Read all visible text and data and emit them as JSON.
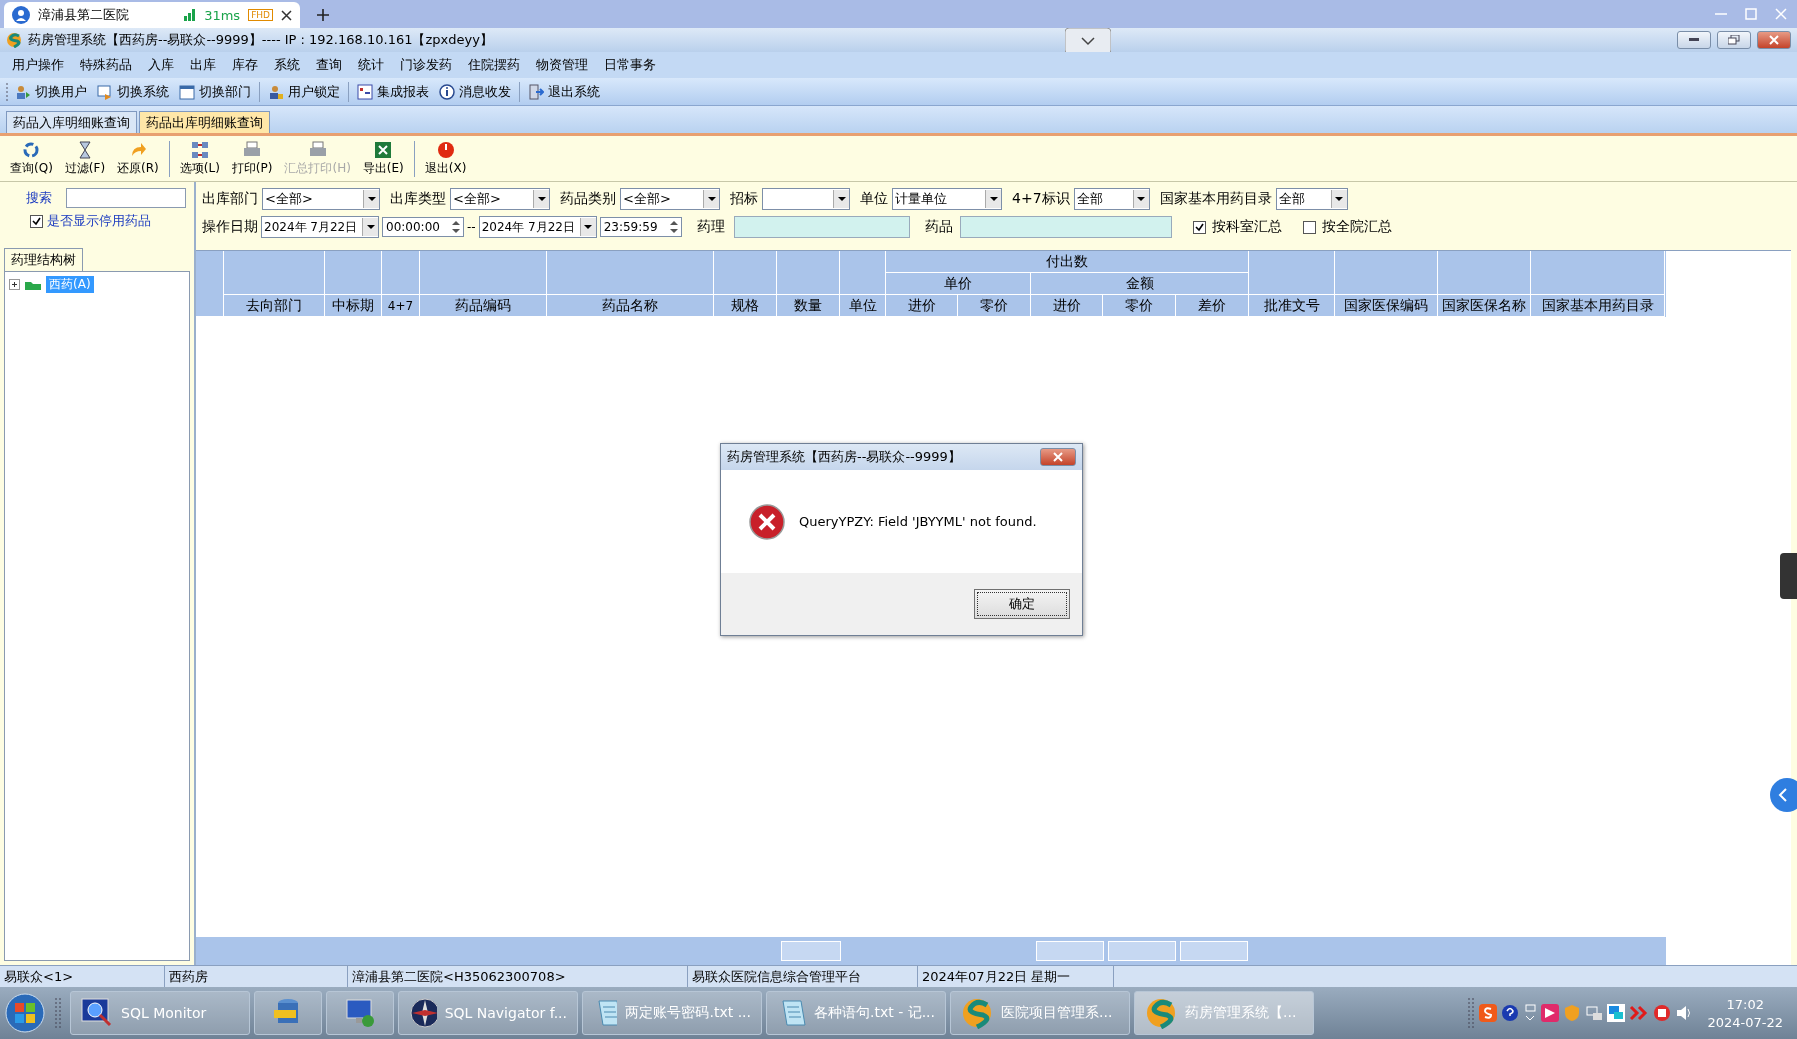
{
  "browser": {
    "tab_title": "漳浦县第二医院",
    "ping": "31ms",
    "quality": "FHD"
  },
  "window": {
    "title": "药房管理系统【西药房--易联众--9999】---- IP : 192.168.10.161【zpxdeyy】"
  },
  "menu": [
    "用户操作",
    "特殊药品",
    "入库",
    "出库",
    "库存",
    "系统",
    "查询",
    "统计",
    "门诊发药",
    "住院摆药",
    "物资管理",
    "日常事务"
  ],
  "toolbar": [
    {
      "label": "切换用户",
      "kind": "users"
    },
    {
      "label": "切换系统",
      "kind": "swap"
    },
    {
      "label": "切换部门",
      "kind": "calendar"
    },
    {
      "label": "用户锁定",
      "kind": "lock"
    },
    {
      "label": "集成报表",
      "kind": "report"
    },
    {
      "label": "消息收发",
      "kind": "info"
    },
    {
      "label": "退出系统",
      "kind": "exit"
    }
  ],
  "tabs": [
    {
      "label": "药品入库明细账查询",
      "selected": false
    },
    {
      "label": "药品出库明细账查询",
      "selected": true
    }
  ],
  "actions": [
    {
      "label": "查询(Q)",
      "kind": "refresh",
      "disabled": false
    },
    {
      "label": "过滤(F)",
      "kind": "filter",
      "disabled": false
    },
    {
      "label": "还原(R)",
      "kind": "undo",
      "disabled": false
    },
    {
      "label": "选项(L)",
      "kind": "options",
      "disabled": false
    },
    {
      "label": "打印(P)",
      "kind": "print",
      "disabled": false
    },
    {
      "label": "汇总打印(H)",
      "kind": "print",
      "disabled": true
    },
    {
      "label": "导出(E)",
      "kind": "excel",
      "disabled": false
    },
    {
      "label": "退出(X)",
      "kind": "power",
      "disabled": false
    }
  ],
  "sidebar": {
    "search_label": "搜索",
    "show_disabled": {
      "label": "是否显示停用药品",
      "checked": true
    },
    "tree_tab": "药理结构树",
    "tree": [
      {
        "label": "西药(A)",
        "expanded": false,
        "selected": true
      }
    ]
  },
  "filters": {
    "row1": [
      {
        "label": "出库部门",
        "value": "<全部>"
      },
      {
        "label": "出库类型",
        "value": "<全部>"
      },
      {
        "label": "药品类别",
        "value": "<全部>"
      },
      {
        "label": "招标"
      },
      {
        "label": "单位",
        "value": "计量单位"
      },
      {
        "label": "4+7标识",
        "value": "全部"
      },
      {
        "label": "国家基本用药目录",
        "value": "全部"
      }
    ],
    "date_label": "操作日期",
    "date_from": "2024年 7月22日",
    "time_from": "00:00:00",
    "dash": "--",
    "date_to": "2024年 7月22日",
    "time_to": "23:59:59",
    "pharm_label": "药理",
    "drug_label": "药品",
    "checks": [
      {
        "label": "按科室汇总",
        "checked": true
      },
      {
        "label": "按全院汇总",
        "checked": false
      }
    ]
  },
  "table": {
    "group": "付出数",
    "subgroups": [
      "单价",
      "金额"
    ],
    "columns": [
      "去向部门",
      "中标期",
      "4+7",
      "药品编码",
      "药品名称",
      "规格",
      "数量",
      "单位",
      "进价",
      "零价",
      "进价",
      "零价",
      "差价",
      "批准文号",
      "国家医保编码",
      "国家医保名称",
      "国家基本用药目录"
    ]
  },
  "dialog": {
    "title": "药房管理系统【西药房--易联众--9999】",
    "message": "QueryYPZY: Field 'JBYYML' not found.",
    "button": "确定"
  },
  "status_bar": [
    "易联众<1>",
    "西药房",
    "漳浦县第二医院<H35062300708>",
    "易联众医院信息综合管理平台",
    "2024年07月22日 星期一"
  ],
  "taskbar": {
    "items": [
      {
        "label": "SQL Monitor",
        "kind": "monitor",
        "active": false
      },
      {
        "kind": "database",
        "active": false
      },
      {
        "kind": "remote",
        "active": false
      },
      {
        "label": "SQL Navigator f...",
        "kind": "compass",
        "active": false
      },
      {
        "label": "两定账号密码.txt ...",
        "kind": "notepad",
        "active": false
      },
      {
        "label": "各种语句.txt - 记...",
        "kind": "notepad",
        "active": false
      },
      {
        "label": "医院项目管理系...",
        "kind": "logo",
        "active": false
      },
      {
        "label": "药房管理系统【...",
        "kind": "logo",
        "active": true
      }
    ],
    "time": "17:02",
    "date": "2024-07-22"
  }
}
